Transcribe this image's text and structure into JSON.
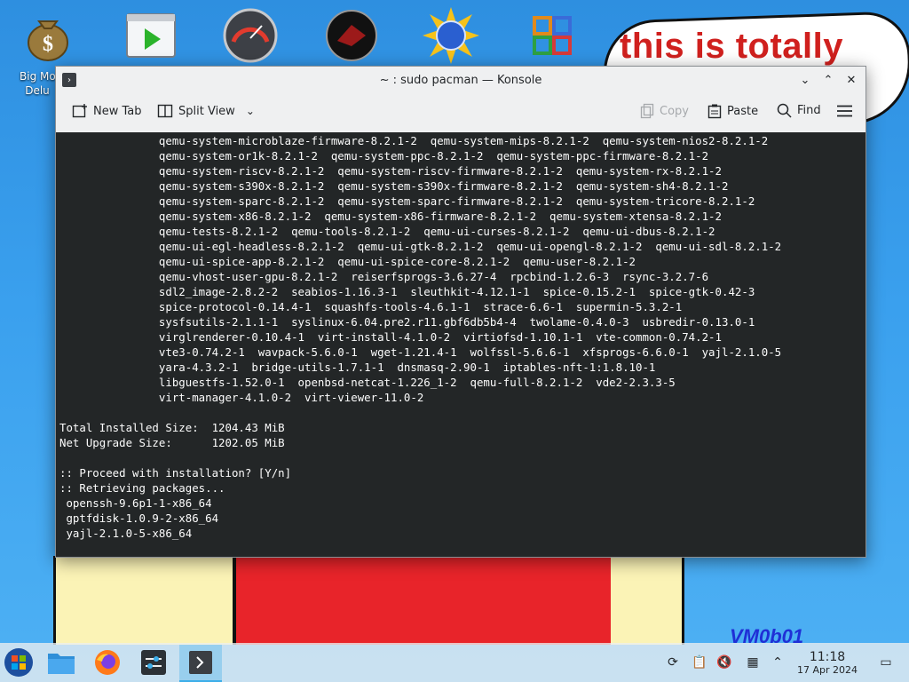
{
  "desktop": {
    "icon_label_partial": "Big Mo\nDelu",
    "icons": [
      "money-bag-icon",
      "video-player-icon",
      "gauge-icon",
      "dark-badge-icon",
      "sun-globe-icon",
      "office-icon"
    ],
    "wallpaper_bubble_text": "this is totally",
    "wallpaper_signature": "VM0b01"
  },
  "window": {
    "title": "~ : sudo pacman — Konsole",
    "toolbar": {
      "new_tab": "New Tab",
      "split_view": "Split View",
      "copy": "Copy",
      "paste": "Paste",
      "find": "Find"
    }
  },
  "terminal": {
    "lines": [
      "               qemu-system-microblaze-firmware-8.2.1-2  qemu-system-mips-8.2.1-2  qemu-system-nios2-8.2.1-2",
      "               qemu-system-or1k-8.2.1-2  qemu-system-ppc-8.2.1-2  qemu-system-ppc-firmware-8.2.1-2",
      "               qemu-system-riscv-8.2.1-2  qemu-system-riscv-firmware-8.2.1-2  qemu-system-rx-8.2.1-2",
      "               qemu-system-s390x-8.2.1-2  qemu-system-s390x-firmware-8.2.1-2  qemu-system-sh4-8.2.1-2",
      "               qemu-system-sparc-8.2.1-2  qemu-system-sparc-firmware-8.2.1-2  qemu-system-tricore-8.2.1-2",
      "               qemu-system-x86-8.2.1-2  qemu-system-x86-firmware-8.2.1-2  qemu-system-xtensa-8.2.1-2",
      "               qemu-tests-8.2.1-2  qemu-tools-8.2.1-2  qemu-ui-curses-8.2.1-2  qemu-ui-dbus-8.2.1-2",
      "               qemu-ui-egl-headless-8.2.1-2  qemu-ui-gtk-8.2.1-2  qemu-ui-opengl-8.2.1-2  qemu-ui-sdl-8.2.1-2",
      "               qemu-ui-spice-app-8.2.1-2  qemu-ui-spice-core-8.2.1-2  qemu-user-8.2.1-2",
      "               qemu-vhost-user-gpu-8.2.1-2  reiserfsprogs-3.6.27-4  rpcbind-1.2.6-3  rsync-3.2.7-6",
      "               sdl2_image-2.8.2-2  seabios-1.16.3-1  sleuthkit-4.12.1-1  spice-0.15.2-1  spice-gtk-0.42-3",
      "               spice-protocol-0.14.4-1  squashfs-tools-4.6.1-1  strace-6.6-1  supermin-5.3.2-1",
      "               sysfsutils-2.1.1-1  syslinux-6.04.pre2.r11.gbf6db5b4-4  twolame-0.4.0-3  usbredir-0.13.0-1",
      "               virglrenderer-0.10.4-1  virt-install-4.1.0-2  virtiofsd-1.10.1-1  vte-common-0.74.2-1",
      "               vte3-0.74.2-1  wavpack-5.6.0-1  wget-1.21.4-1  wolfssl-5.6.6-1  xfsprogs-6.6.0-1  yajl-2.1.0-5",
      "               yara-4.3.2-1  bridge-utils-1.7.1-1  dnsmasq-2.90-1  iptables-nft-1:1.8.10-1",
      "               libguestfs-1.52.0-1  openbsd-netcat-1.226_1-2  qemu-full-8.2.1-2  vde2-2.3.3-5",
      "               virt-manager-4.1.0-2  virt-viewer-11.0-2",
      "",
      "Total Installed Size:  1204.43 MiB",
      "Net Upgrade Size:      1202.05 MiB",
      "",
      ":: Proceed with installation? [Y/n]",
      ":: Retrieving packages...",
      " openssh-9.6p1-1-x86_64",
      " gptfdisk-1.0.9-2-x86_64",
      " yajl-2.1.0-5-x86_64"
    ]
  },
  "taskbar": {
    "items": [
      "start-menu-icon",
      "file-manager-icon",
      "firefox-icon",
      "settings-icon",
      "konsole-icon"
    ],
    "clock_time": "11:18",
    "clock_date": "17 Apr 2024"
  }
}
